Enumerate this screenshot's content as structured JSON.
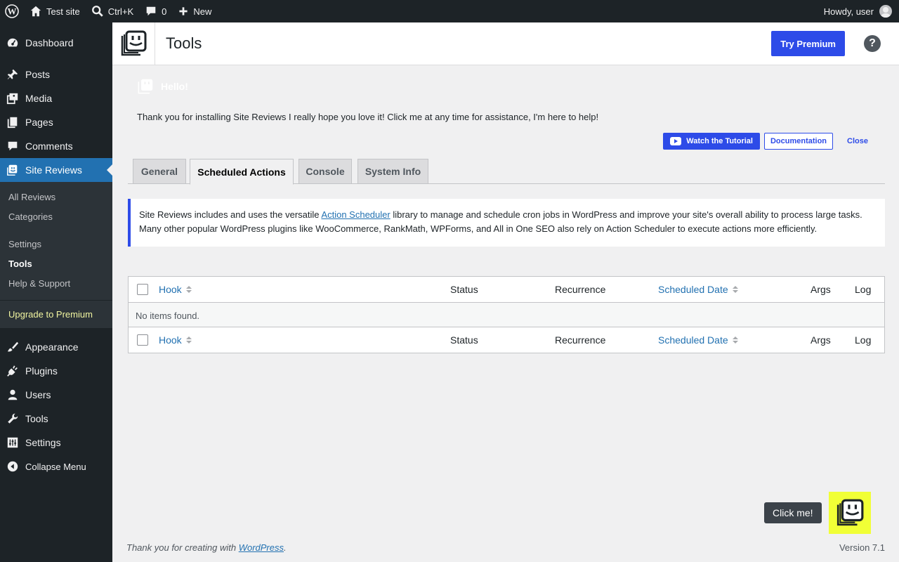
{
  "adminbar": {
    "site_name": "Test site",
    "search_shortcut": "Ctrl+K",
    "comments_count": "0",
    "new_label": "New",
    "howdy": "Howdy, user"
  },
  "sidebar": {
    "items_top": [
      {
        "label": "Dashboard",
        "icon": "dashboard-icon"
      },
      {
        "label": "Posts",
        "icon": "pin-icon"
      },
      {
        "label": "Media",
        "icon": "media-icon"
      },
      {
        "label": "Pages",
        "icon": "pages-icon"
      },
      {
        "label": "Comments",
        "icon": "comment-icon"
      },
      {
        "label": "Site Reviews",
        "icon": "site-reviews-icon"
      }
    ],
    "submenu": [
      "All Reviews",
      "Categories",
      "Settings",
      "Tools",
      "Help & Support",
      "Upgrade to Premium"
    ],
    "items_bottom": [
      {
        "label": "Appearance",
        "icon": "brush-icon"
      },
      {
        "label": "Plugins",
        "icon": "plug-icon"
      },
      {
        "label": "Users",
        "icon": "user-icon"
      },
      {
        "label": "Tools",
        "icon": "wrench-icon"
      },
      {
        "label": "Settings",
        "icon": "sliders-icon"
      },
      {
        "label": "Collapse Menu",
        "icon": "collapse-icon"
      }
    ]
  },
  "header": {
    "title": "Tools",
    "try_premium": "Try Premium",
    "help": "?"
  },
  "notice": {
    "hello": "Hello!",
    "message": "Thank you for installing Site Reviews I really hope you love it! Click me at any time for assistance, I'm here to help!",
    "watch_tutorial": "Watch the Tutorial",
    "documentation": "Documentation",
    "close": "Close"
  },
  "tabs": [
    "General",
    "Scheduled Actions",
    "Console",
    "System Info"
  ],
  "active_tab": "Scheduled Actions",
  "info": {
    "before": "Site Reviews includes and uses the versatile ",
    "link": "Action Scheduler",
    "after": " library to manage and schedule cron jobs in WordPress and improve your site's overall ability to process large tasks. Many other popular WordPress plugins like WooCommerce, RankMath, WPForms, and All in One SEO also rely on Action Scheduler to execute actions more efficiently."
  },
  "table": {
    "columns": {
      "hook": "Hook",
      "status": "Status",
      "recurrence": "Recurrence",
      "scheduled_date": "Scheduled Date",
      "args": "Args",
      "log": "Log"
    },
    "empty": "No items found."
  },
  "footer": {
    "thanks_before": "Thank you for creating with ",
    "thanks_link": "WordPress",
    "thanks_after": ".",
    "version": "Version 7.1"
  },
  "assistant": {
    "click_me": "Click me!"
  },
  "colors": {
    "accent": "#2d4be8",
    "admin_bg": "#1d2327",
    "mascot_bg": "#f1ff36"
  }
}
